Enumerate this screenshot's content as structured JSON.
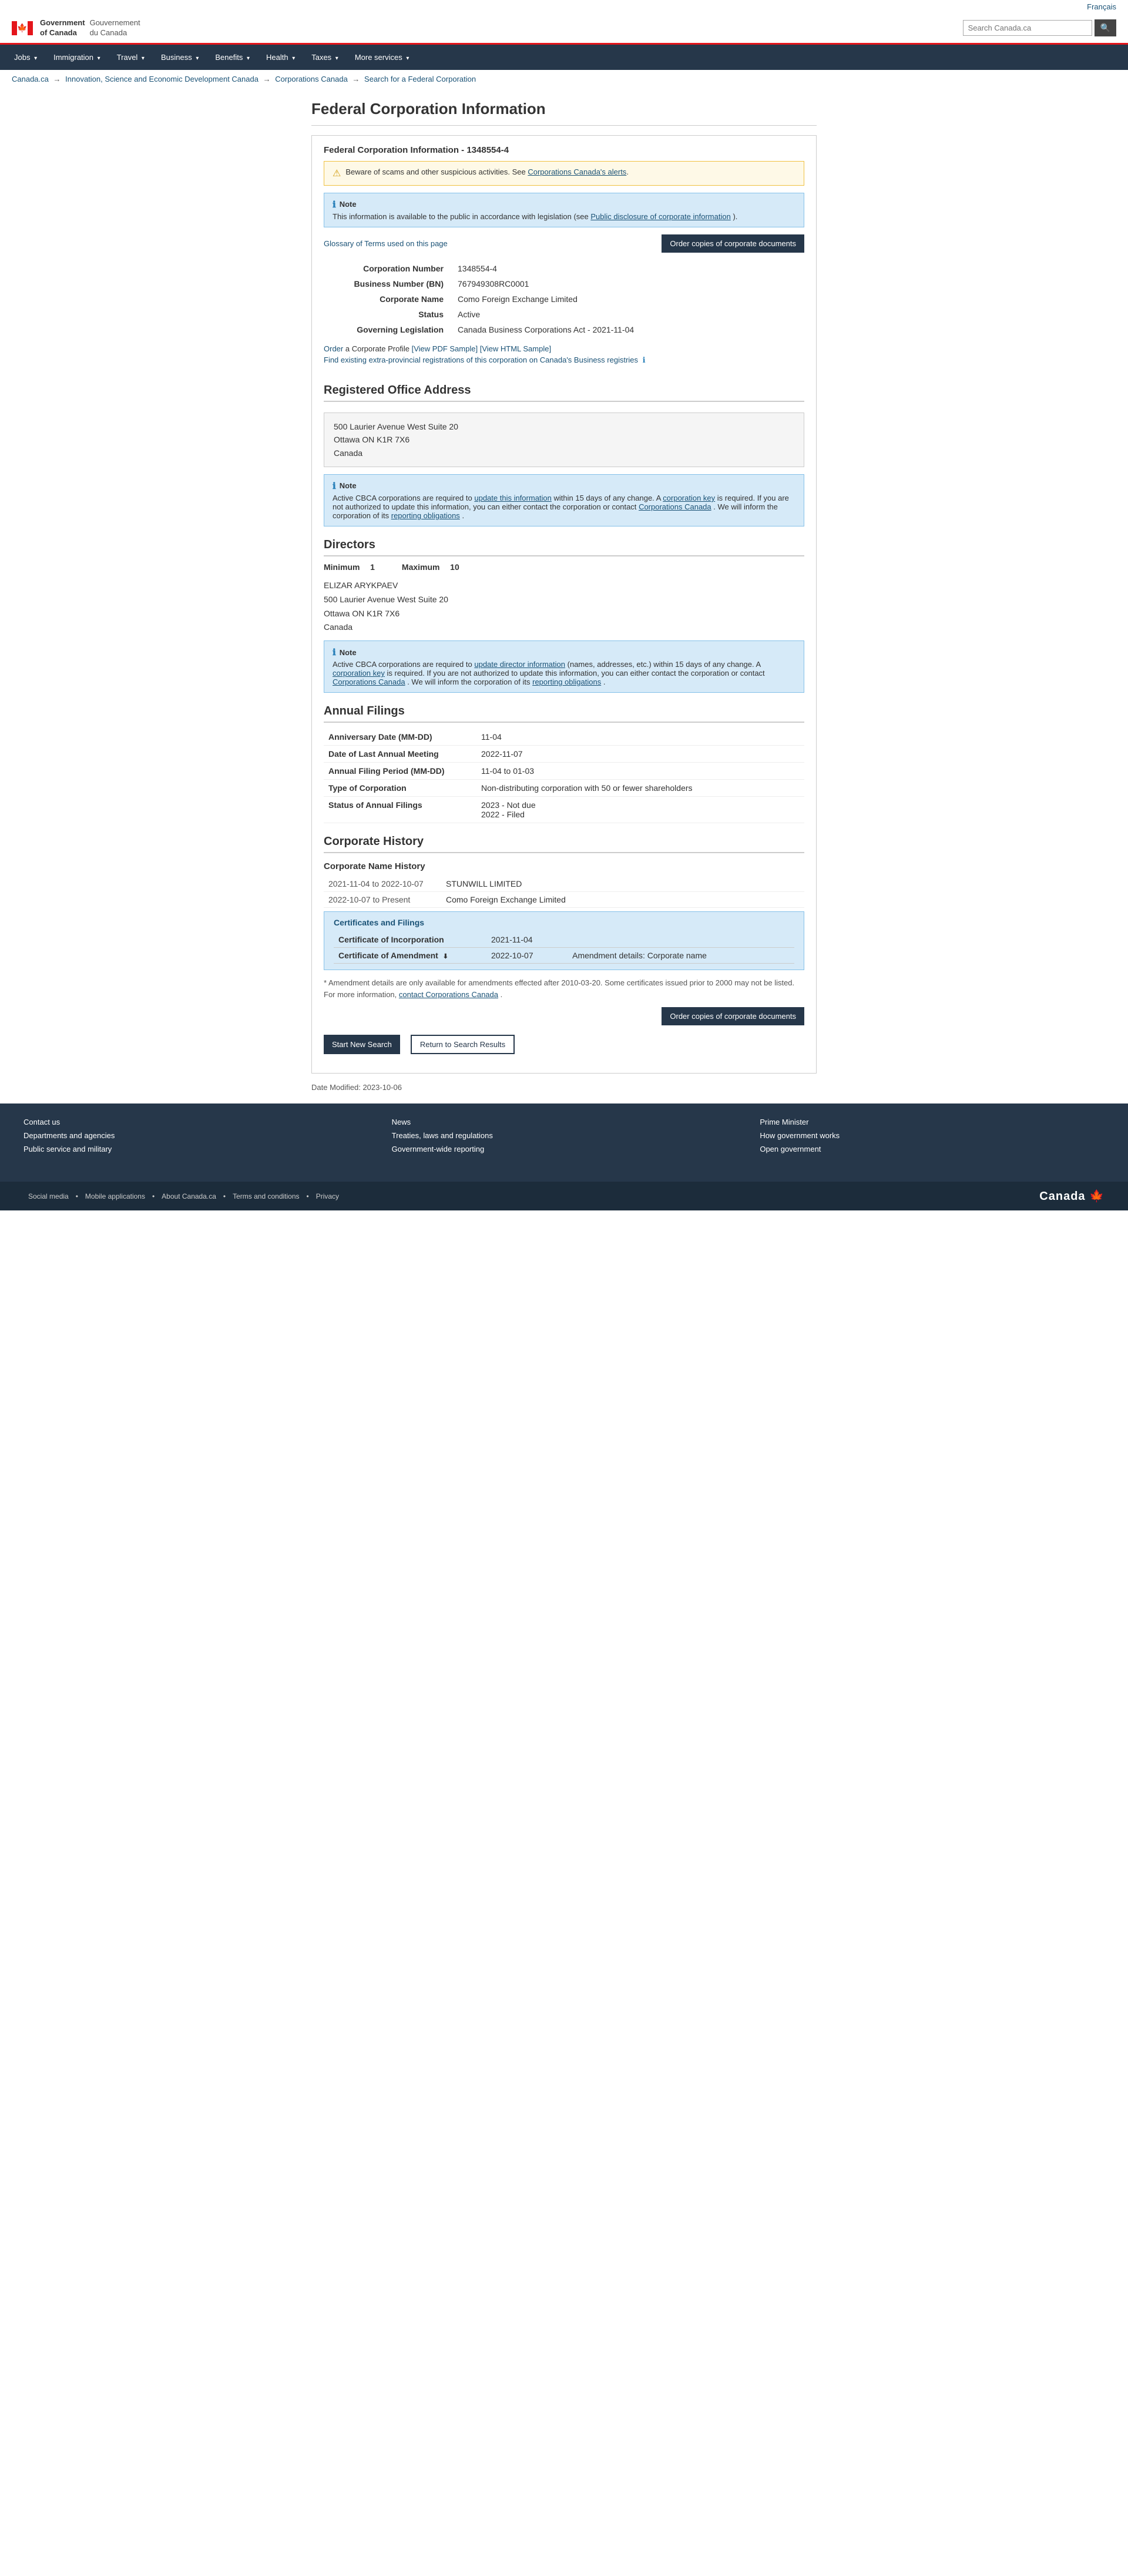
{
  "lang": {
    "french": "Français"
  },
  "header": {
    "gov_en_line1": "Government",
    "gov_en_line2": "of Canada",
    "gov_fr_line1": "Gouvernement",
    "gov_fr_line2": "du Canada",
    "search_placeholder": "Search Canada.ca",
    "search_label": "🔍"
  },
  "nav": {
    "items": [
      {
        "label": "Jobs",
        "has_arrow": true
      },
      {
        "label": "Immigration",
        "has_arrow": true
      },
      {
        "label": "Travel",
        "has_arrow": true
      },
      {
        "label": "Business",
        "has_arrow": true
      },
      {
        "label": "Benefits",
        "has_arrow": true
      },
      {
        "label": "Health",
        "has_arrow": true
      },
      {
        "label": "Taxes",
        "has_arrow": true
      },
      {
        "label": "More services",
        "has_arrow": true
      }
    ]
  },
  "breadcrumb": {
    "items": [
      {
        "label": "Canada.ca",
        "url": "#"
      },
      {
        "label": "Innovation, Science and Economic Development Canada",
        "url": "#"
      },
      {
        "label": "Corporations Canada",
        "url": "#"
      },
      {
        "label": "Search for a Federal Corporation",
        "url": "#"
      }
    ]
  },
  "page": {
    "title": "Federal Corporation Information",
    "box_title": "Federal Corporation Information - 1348554-4",
    "warning_text": "Beware of scams and other suspicious activities. See",
    "warning_link_text": "Corporations Canada's alerts",
    "note_title": "Note",
    "note_text": "This information is available to the public in accordance with legislation (see",
    "note_link_text": "Public disclosure of corporate information",
    "note_text2": ").",
    "glossary_link": "Glossary of Terms used on this page",
    "order_btn": "Order copies of corporate documents",
    "corp_number_label": "Corporation Number",
    "corp_number_value": "1348554-4",
    "bn_label": "Business Number (BN)",
    "bn_value": "767949308RC0001",
    "corp_name_label": "Corporate Name",
    "corp_name_value": "Como Foreign Exchange Limited",
    "status_label": "Status",
    "status_value": "Active",
    "governing_label": "Governing Legislation",
    "governing_value": "Canada Business Corporations Act - 2021-11-04",
    "order_profile_text": "Order",
    "order_profile_rest": " a Corporate Profile",
    "view_pdf": "[View PDF Sample]",
    "view_html": "[View HTML Sample]",
    "find_registrations": "Find existing extra-provincial registrations of this corporation on Canada's Business registries",
    "registered_office_title": "Registered Office Address",
    "address_line1": "500 Laurier Avenue West Suite 20",
    "address_line2": "Ottawa ON K1R 7X6",
    "address_line3": "Canada",
    "office_note_title": "Note",
    "office_note_text": "Active CBCA corporations are required to",
    "office_note_link1": "update this information",
    "office_note_mid1": " within 15 days of any change. A",
    "office_note_link2": "corporation key",
    "office_note_mid2": " is required. If you are not authorized to update this information, you can either contact the corporation or contact",
    "office_note_link3": "Corporations Canada",
    "office_note_mid3": ". We will inform the corporation of its",
    "office_note_link4": "reporting obligations",
    "office_note_end": ".",
    "directors_title": "Directors",
    "directors_min_label": "Minimum",
    "directors_min_value": "1",
    "directors_max_label": "Maximum",
    "directors_max_value": "10",
    "director_name": "ELIZAR ARYKPAEV",
    "director_addr1": "500 Laurier Avenue West Suite 20",
    "director_addr2": "Ottawa ON K1R 7X6",
    "director_addr3": "Canada",
    "director_note_title": "Note",
    "director_note_text": "Active CBCA corporations are required to",
    "director_note_link1": "update director information",
    "director_note_mid1": " (names, addresses, etc.) within 15 days of any change. A",
    "director_note_link2": "corporation key",
    "director_note_mid2": " is required. If you are not authorized to update this information, you can either contact the corporation or contact",
    "director_note_link3": "Corporations Canada",
    "director_note_mid3": ". We will inform the corporation of its",
    "director_note_link4": "reporting obligations",
    "director_note_end": ".",
    "annual_title": "Annual Filings",
    "anniversary_label": "Anniversary Date (MM-DD)",
    "anniversary_value": "11-04",
    "last_meeting_label": "Date of Last Annual Meeting",
    "last_meeting_value": "2022-11-07",
    "filing_period_label": "Annual Filing Period (MM-DD)",
    "filing_period_value": "11-04 to 01-03",
    "corp_type_label": "Type of Corporation",
    "corp_type_value": "Non-distributing corporation with 50 or fewer shareholders",
    "annual_status_label": "Status of Annual Filings",
    "annual_status_value1": "2023 - Not due",
    "annual_status_value2": "2022 - Filed",
    "history_title": "Corporate History",
    "name_history_title": "Corporate Name History",
    "history_row1_date": "2021-11-04 to 2022-10-07",
    "history_row1_name": "STUNWILL LIMITED",
    "history_row2_date": "2022-10-07 to Present",
    "history_row2_name": "Como Foreign Exchange Limited",
    "certs_title": "Certificates and Filings",
    "cert_incorp_label": "Certificate of Incorporation",
    "cert_incorp_date": "2021-11-04",
    "cert_amend_label": "Certificate of Amendment",
    "cert_amend_date": "2022-10-07",
    "cert_amend_details": "Amendment details: Corporate name",
    "amendment_note": "* Amendment details are only available for amendments effected after 2010-03-20. Some certificates issued prior to 2000 may not be listed. For more information,",
    "amendment_note_link": "contact Corporations Canada",
    "amendment_note_end": ".",
    "order_btn2": "Order copies of corporate documents",
    "start_search_btn": "Start New Search",
    "return_btn": "Return to Search Results",
    "date_modified_label": "Date Modified:",
    "date_modified_value": "2023-10-06"
  },
  "footer": {
    "cols": [
      {
        "links": [
          "Contact us",
          "Departments and agencies",
          "Public service and military"
        ]
      },
      {
        "links": [
          "News",
          "Treaties, laws and regulations",
          "Government-wide reporting"
        ]
      },
      {
        "links": [
          "Prime Minister",
          "How government works",
          "Open government"
        ]
      }
    ],
    "bottom_links": [
      "Social media",
      "Mobile applications",
      "About Canada.ca",
      "Terms and conditions",
      "Privacy"
    ],
    "wordmark": "Canada"
  }
}
